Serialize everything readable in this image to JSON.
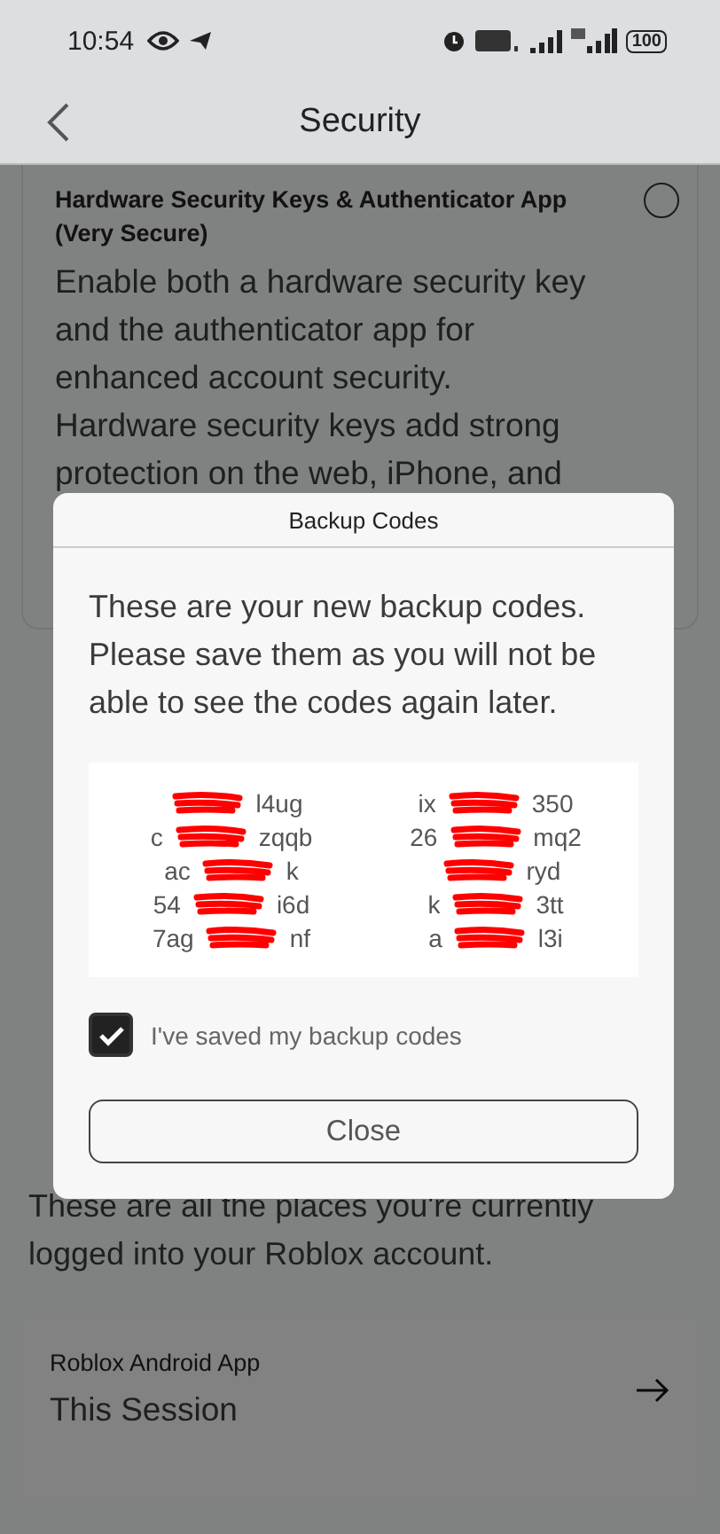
{
  "status_bar": {
    "time": "10:54",
    "battery": "100"
  },
  "header": {
    "title": "Security"
  },
  "security_option": {
    "title": "Hardware Security Keys & Authenticator App (Very Secure)",
    "selected": false,
    "description": "Enable both a hardware security key and the authenticator app for enhanced account security. Hardware security keys add strong protection on the web, iPhone, and"
  },
  "sessions": {
    "description": "These are all the places you're currently logged into your Roblox account.",
    "items": [
      {
        "app": "Roblox Android App",
        "label": "This Session"
      }
    ]
  },
  "dialog": {
    "title": "Backup Codes",
    "message": "These are your new backup codes. Please save them as you will not be able to see the codes again later.",
    "codes": [
      {
        "end": "l4ug"
      },
      {
        "start": "ix",
        "end": "350"
      },
      {
        "start": "c",
        "end": "zqqb"
      },
      {
        "start": "26",
        "end": "mq2"
      },
      {
        "start": "ac",
        "end": "k"
      },
      {
        "end": "ryd"
      },
      {
        "start": "54",
        "end": "i6d"
      },
      {
        "start": "k",
        "end": "3tt"
      },
      {
        "start": "7ag",
        "end": "nf"
      },
      {
        "start": "a",
        "end": "l3i"
      }
    ],
    "confirm": {
      "label": "I've saved my backup codes",
      "checked": true
    },
    "button": "Close"
  }
}
